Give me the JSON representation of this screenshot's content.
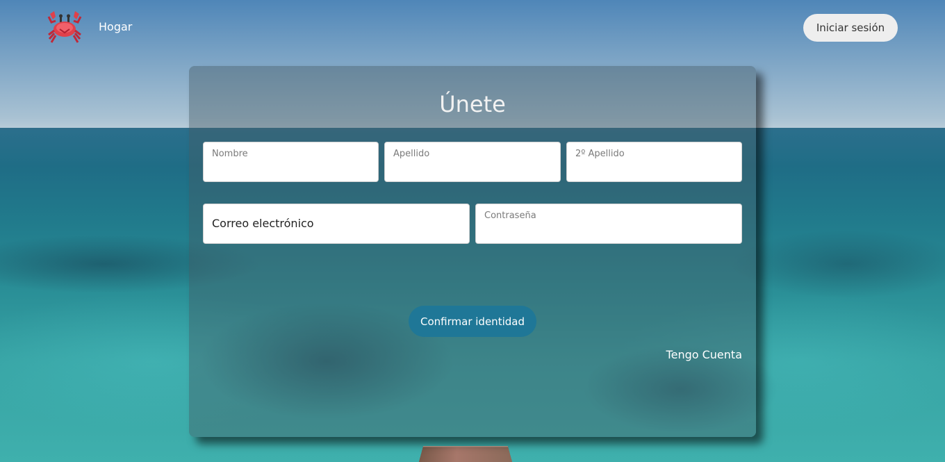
{
  "header": {
    "logo_icon": "crab-icon",
    "home_label": "Hogar",
    "login_label": "Iniciar sesión"
  },
  "form": {
    "title": "Únete",
    "fields": {
      "first_name": {
        "label": "Nombre",
        "value": ""
      },
      "last_name": {
        "label": "Apellido",
        "value": ""
      },
      "second_last_name": {
        "label": "2º Apellido",
        "value": ""
      },
      "email": {
        "label": "",
        "value": "Correo electrónico"
      },
      "password": {
        "label": "Contraseña",
        "value": ""
      }
    },
    "confirm_label": "Confirmar identidad",
    "have_account_label": "Tengo Cuenta"
  },
  "colors": {
    "primary_button": "#1f7797",
    "logo_red": "#e0404a"
  }
}
